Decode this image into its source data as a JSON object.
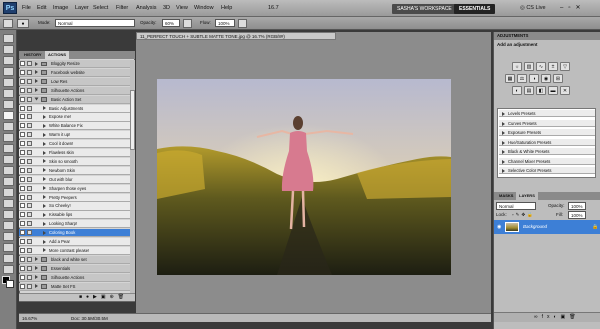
{
  "app": {
    "logo": "Ps"
  },
  "menu": [
    "File",
    "Edit",
    "Image",
    "Layer",
    "Select",
    "Filter",
    "Analysis",
    "3D",
    "View",
    "Window",
    "Help"
  ],
  "menu_extra": {
    "zoom": "16.7",
    "workspace": "SASHA'S WORKSPACE",
    "essentials": "ESSENTIALS",
    "cslive": "CS Live"
  },
  "options": {
    "mode_label": "Mode:",
    "mode_value": "Normal",
    "opacity_label": "Opacity:",
    "opacity_value": "60%",
    "flow_label": "Flow:",
    "flow_value": "100%"
  },
  "document": {
    "tab_title": "11_PERFECT TOUCH + SUBTLE MATTE TONE.jpg @ 16.7% (RGB/8#)"
  },
  "actions_panel": {
    "tab_history": "HISTORY",
    "tab_actions": "ACTIONS",
    "items": [
      {
        "label": "Bloggity Resize",
        "kind": "set",
        "indent": 1
      },
      {
        "label": "Facebook website",
        "kind": "set",
        "indent": 1
      },
      {
        "label": "Low Res",
        "kind": "set",
        "indent": 1
      },
      {
        "label": "Silhouette Actions",
        "kind": "set",
        "indent": 1
      },
      {
        "label": "Basic Action Set",
        "kind": "setopen",
        "indent": 1
      },
      {
        "label": "Basic Adjustments",
        "kind": "action",
        "indent": 2
      },
      {
        "label": "Expose me!",
        "kind": "action",
        "indent": 2
      },
      {
        "label": "White Balance Fix",
        "kind": "action",
        "indent": 2
      },
      {
        "label": "Warm it up!",
        "kind": "action",
        "indent": 2
      },
      {
        "label": "Cool it down!",
        "kind": "action",
        "indent": 2
      },
      {
        "label": "Flawless skin",
        "kind": "action",
        "indent": 2
      },
      {
        "label": "Skin so smooth",
        "kind": "action",
        "indent": 2
      },
      {
        "label": "Newborn Skin",
        "kind": "action",
        "indent": 2
      },
      {
        "label": "Out with blur",
        "kind": "action",
        "indent": 2
      },
      {
        "label": "Sharpen those eyes",
        "kind": "action",
        "indent": 2
      },
      {
        "label": "Pretty Peepers",
        "kind": "action",
        "indent": 2
      },
      {
        "label": "So Cheeky!",
        "kind": "action",
        "indent": 2
      },
      {
        "label": "Kissable lips",
        "kind": "action",
        "indent": 2
      },
      {
        "label": "Looking Sharp!",
        "kind": "action",
        "indent": 2
      },
      {
        "label": "Coloring Book",
        "kind": "selected",
        "indent": 2
      },
      {
        "label": "Add a Pear",
        "kind": "action",
        "indent": 2
      },
      {
        "label": "More contrast please!",
        "kind": "action",
        "indent": 2
      },
      {
        "label": "black and white set",
        "kind": "set",
        "indent": 1
      },
      {
        "label": "Essentials",
        "kind": "set",
        "indent": 1
      },
      {
        "label": "Silhouette Actions",
        "kind": "set",
        "indent": 1
      },
      {
        "label": "Matte Set FS",
        "kind": "set",
        "indent": 1
      }
    ]
  },
  "adjustments": {
    "header": "ADJUSTMENTS",
    "subheader": "Add an adjustment",
    "presets": [
      "Levels Presets",
      "Curves Presets",
      "Exposure Presets",
      "Hue/Saturation Presets",
      "Black & White Presets",
      "Channel Mixer Presets",
      "Selective Color Presets"
    ]
  },
  "layers": {
    "tab_masks": "MASKS",
    "tab_layers": "LAYERS",
    "blend": "Normal",
    "opacity_label": "Opacity:",
    "opacity": "100%",
    "lock_label": "Lock:",
    "fill_label": "Fill:",
    "fill": "100%",
    "layer_name": "Background"
  },
  "status": {
    "zoom": "16.67%",
    "doc": "Doc: 30.5M/30.5M"
  },
  "colors": {
    "accent": "#3d7fd6",
    "panel": "#d4d4d4",
    "menubar": "#ababab",
    "canvas": "#8c8c8c",
    "workspace": "#4b4b4b",
    "essentials": "#232323"
  }
}
